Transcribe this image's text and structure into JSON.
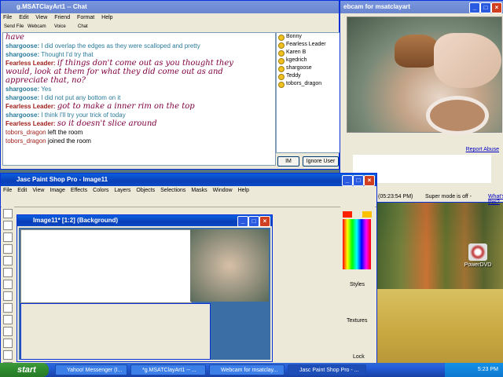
{
  "chat": {
    "title": "g.MSATClayArt1 -- Chat",
    "menu": [
      "File",
      "Edit",
      "View",
      "Friend",
      "Format",
      "Help"
    ],
    "toolbar": [
      "Send File",
      "Webcam",
      "Voice",
      "Chat"
    ],
    "messages": [
      {
        "who": "",
        "text": "have",
        "kind": "fl"
      },
      {
        "who": "shargoose:",
        "text": "I did overlap the edges as they were scalloped and pretty",
        "kind": "sg"
      },
      {
        "who": "shargoose:",
        "text": "Thought I'd try that",
        "kind": "sg"
      },
      {
        "who": "Fearless Leader:",
        "text": "if things don't come out as you thought they",
        "kind": "fl"
      },
      {
        "who": "",
        "text": "would, look at them for what they did come out as and",
        "kind": "fl"
      },
      {
        "who": "",
        "text": "appreciate that, no?",
        "kind": "fl"
      },
      {
        "who": "shargoose:",
        "text": "Yes",
        "kind": "sg"
      },
      {
        "who": "shargoose:",
        "text": "I did not put any bottom on it",
        "kind": "sg"
      },
      {
        "who": "Fearless Leader:",
        "text": "got to make a inner rim on the top",
        "kind": "fl"
      },
      {
        "who": "shargoose:",
        "text": "I think I'll try your trick of today",
        "kind": "sg"
      },
      {
        "who": "Fearless Leader:",
        "text": "so it doesn't slice around",
        "kind": "fl"
      },
      {
        "who": "tobors_dragon",
        "text": "left the room",
        "kind": "sys"
      },
      {
        "who": "tobors_dragon",
        "text": "joined the room",
        "kind": "sys"
      }
    ],
    "users": [
      "Bonny",
      "Fearless Leader",
      "Karen B",
      "kgedrich",
      "shargoose",
      "Teddy",
      "tobors_dragon"
    ],
    "im_label": "IM",
    "ignore_label": "Ignore User"
  },
  "webcam": {
    "title": "ebcam for msatclayart",
    "report_abuse": "Report Abuse",
    "timestamp": "(05:23:54 PM)",
    "super_mode": "Super mode is off -",
    "whats_this": "What's this?"
  },
  "psp": {
    "title": "Jasc Paint Shop Pro - Image11",
    "menu": [
      "File",
      "Edit",
      "View",
      "Image",
      "Effects",
      "Colors",
      "Layers",
      "Objects",
      "Selections",
      "Masks",
      "Window",
      "Help"
    ],
    "image_title": "Image11* [1:2] (Background)",
    "styles_label": "Styles",
    "textures_label": "Textures",
    "lock_label": "Lock"
  },
  "desktop": {
    "icon_label": "PowerDVD"
  },
  "taskbar": {
    "start_label": "start",
    "tasks": [
      "Yahoo! Messenger (I...",
      "*g.MSATClayArt1 -- ...",
      "Webcam for msatclay...",
      "Jasc Paint Shop Pro - ..."
    ],
    "clock": "5:23 PM"
  },
  "colors": {
    "xp_blue": "#0a5fe0",
    "start_green": "#2e8a2e",
    "chat_user": "#2a7a9a",
    "chat_leader": "#a0201c"
  }
}
